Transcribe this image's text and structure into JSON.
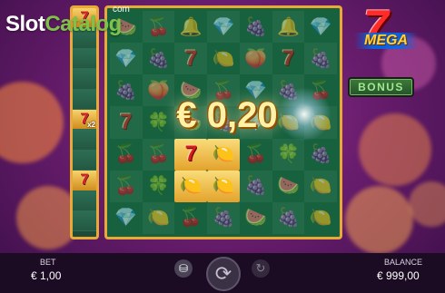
{
  "logo": {
    "main_a": "Slot",
    "main_b": "Catalog",
    "suffix": "com"
  },
  "side_column": {
    "cells": [
      {
        "symbol": "seven"
      },
      {
        "symbol": "empty"
      },
      {
        "symbol": "empty"
      },
      {
        "symbol": "empty"
      },
      {
        "symbol": "empty"
      },
      {
        "symbol": "seven",
        "multiplier": "x2"
      },
      {
        "symbol": "empty"
      },
      {
        "symbol": "empty"
      },
      {
        "symbol": "seven"
      },
      {
        "symbol": "empty"
      },
      {
        "symbol": "empty"
      }
    ]
  },
  "grid": {
    "rows": [
      [
        "melon",
        "cherry",
        "bell",
        "diamond",
        "grape",
        "bell",
        "diamond"
      ],
      [
        "diamond",
        "grape",
        "seven",
        "lemon",
        "plum",
        "seven",
        "grape"
      ],
      [
        "grape",
        "plum",
        "melon",
        "cherry",
        "diamond",
        "grape",
        "cherry"
      ],
      [
        "seven",
        "clover",
        "melon",
        "grape",
        "diamond",
        "lemon",
        "lemon"
      ],
      [
        "cherry",
        "cherry",
        "seven",
        "lemon",
        "cherry",
        "clover",
        "grape"
      ],
      [
        "cherry",
        "clover",
        "lemon",
        "lemon",
        "grape",
        "melon",
        "lemon"
      ],
      [
        "diamond",
        "lemon",
        "cherry",
        "grape",
        "melon",
        "grape",
        "lemon"
      ]
    ],
    "win_cells": [
      [
        4,
        2
      ],
      [
        4,
        3
      ],
      [
        5,
        2
      ],
      [
        5,
        3
      ]
    ]
  },
  "win_amount": "€ 0,20",
  "game_logo": {
    "seven": "7",
    "text": "MEGA"
  },
  "bonus_button": {
    "label": "BONUS"
  },
  "bet": {
    "label": "BET",
    "value": "€ 1,00"
  },
  "balance": {
    "label": "BALANCE",
    "value": "€ 999,00"
  },
  "controls": {
    "coin_icon": "coins-icon",
    "spin_icon": "spin-arrows-icon",
    "auto_icon": "autoplay-icon"
  }
}
